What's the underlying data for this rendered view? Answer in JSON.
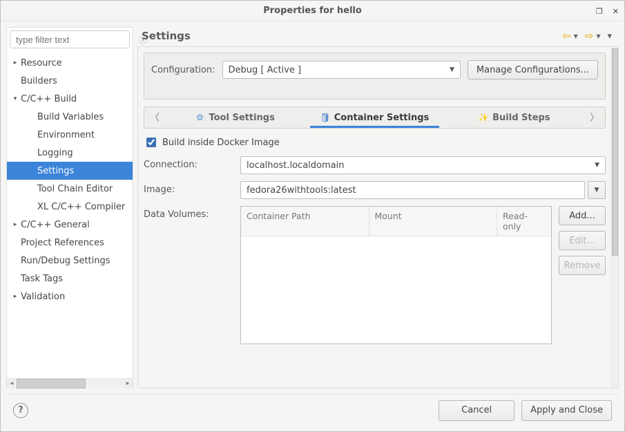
{
  "window": {
    "title": "Properties for hello"
  },
  "filter": {
    "placeholder": "type filter text"
  },
  "tree": {
    "items": [
      {
        "label": "Resource",
        "depth": 0,
        "twisty": "▸",
        "selected": false
      },
      {
        "label": "Builders",
        "depth": 0,
        "twisty": "",
        "selected": false
      },
      {
        "label": "C/C++ Build",
        "depth": 0,
        "twisty": "▾",
        "selected": false
      },
      {
        "label": "Build Variables",
        "depth": 1,
        "twisty": "",
        "selected": false
      },
      {
        "label": "Environment",
        "depth": 1,
        "twisty": "",
        "selected": false
      },
      {
        "label": "Logging",
        "depth": 1,
        "twisty": "",
        "selected": false
      },
      {
        "label": "Settings",
        "depth": 1,
        "twisty": "",
        "selected": true
      },
      {
        "label": "Tool Chain Editor",
        "depth": 1,
        "twisty": "",
        "selected": false
      },
      {
        "label": "XL C/C++ Compiler",
        "depth": 1,
        "twisty": "",
        "selected": false
      },
      {
        "label": "C/C++ General",
        "depth": 0,
        "twisty": "▸",
        "selected": false
      },
      {
        "label": "Project References",
        "depth": 0,
        "twisty": "",
        "selected": false
      },
      {
        "label": "Run/Debug Settings",
        "depth": 0,
        "twisty": "",
        "selected": false
      },
      {
        "label": "Task Tags",
        "depth": 0,
        "twisty": "",
        "selected": false
      },
      {
        "label": "Validation",
        "depth": 0,
        "twisty": "▸",
        "selected": false
      }
    ]
  },
  "page": {
    "title": "Settings"
  },
  "config": {
    "label": "Configuration:",
    "value": "Debug  [ Active ]",
    "manage": "Manage Configurations..."
  },
  "tabs": {
    "tool": "Tool Settings",
    "container": "Container Settings",
    "build": "Build Steps"
  },
  "form": {
    "build_inside": "Build inside Docker Image",
    "connection_label": "Connection:",
    "connection_value": "localhost.localdomain",
    "image_label": "Image:",
    "image_value": "fedora26withtools:latest",
    "volumes_label": "Data Volumes:",
    "col_cp": "Container Path",
    "col_mount": "Mount",
    "col_ro": "Read-only",
    "add": "Add...",
    "edit": "Edit...",
    "remove": "Remove"
  },
  "footer": {
    "cancel": "Cancel",
    "apply": "Apply and Close"
  }
}
